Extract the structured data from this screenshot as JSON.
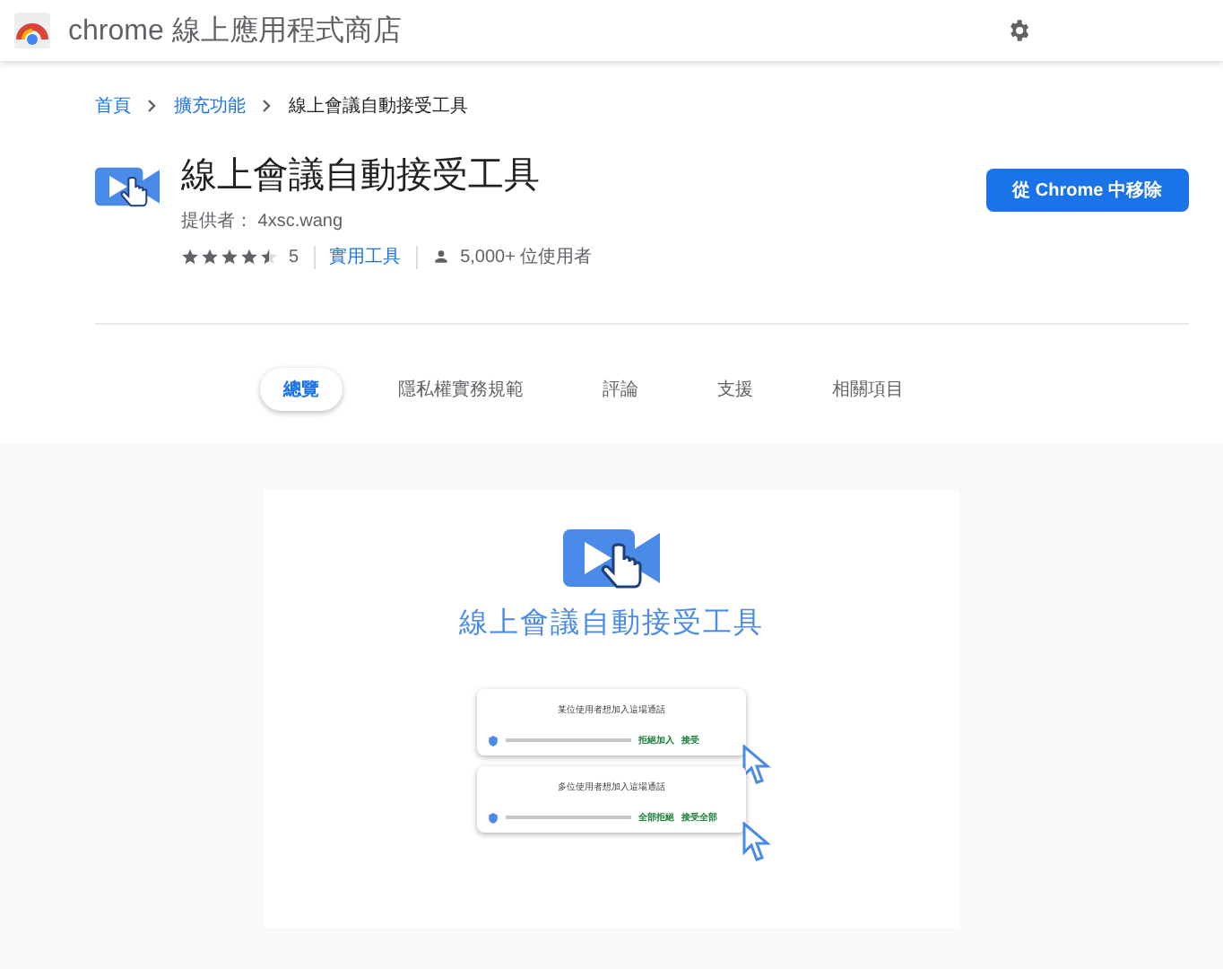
{
  "header": {
    "title": "chrome 線上應用程式商店"
  },
  "breadcrumb": [
    {
      "label": "首頁",
      "link": true
    },
    {
      "label": "擴充功能",
      "link": true
    },
    {
      "label": "線上會議自動接受工具",
      "link": false
    }
  ],
  "extension": {
    "name": "線上會議自動接受工具",
    "provider": "提供者： 4xsc.wang",
    "stars": 4.5,
    "rating_count": "5",
    "category": "實用工具",
    "users": "5,000+ 位使用者",
    "action_button": "從 Chrome 中移除"
  },
  "tabs": [
    {
      "label": "總覽",
      "selected": true
    },
    {
      "label": "隱私權實務規範",
      "selected": false
    },
    {
      "label": "評論",
      "selected": false
    },
    {
      "label": "支援",
      "selected": false
    },
    {
      "label": "相關項目",
      "selected": false
    }
  ],
  "preview": {
    "title": "線上會議自動接受工具",
    "dialogs": [
      {
        "heading": "某位使用者想加入這場通話",
        "buttons": [
          "拒絕加入",
          "接受"
        ]
      },
      {
        "heading": "多位使用者想加入這場通話",
        "buttons": [
          "全部拒絕",
          "接受全部"
        ]
      }
    ]
  }
}
